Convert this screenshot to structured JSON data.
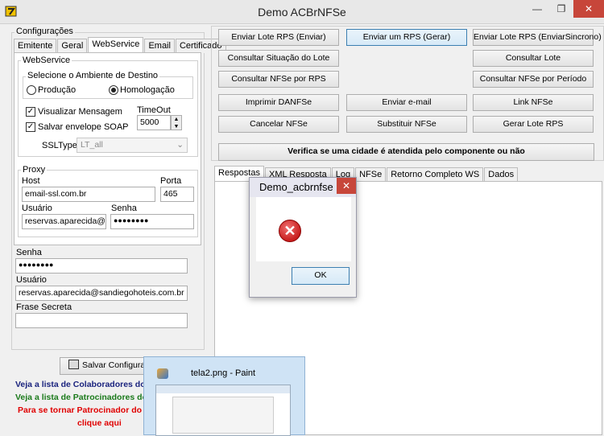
{
  "window": {
    "title": "Demo ACBrNFSe",
    "min": "—",
    "max": "❐",
    "close": "✕"
  },
  "config": {
    "group_label": "Configurações",
    "tabs": [
      "Emitente",
      "Geral",
      "WebService",
      "Email",
      "Certificado"
    ],
    "ws_group": "WebService",
    "ambiente_group": "Selecione o Ambiente de Destino",
    "producao": "Produção",
    "homologacao": "Homologação",
    "visualizar": "Visualizar Mensagem",
    "salvar_soap": "Salvar envelope SOAP",
    "timeout_label": "TimeOut",
    "timeout_value": "5000",
    "ssltype_label": "SSLType",
    "ssltype_value": "LT_all",
    "proxy_group": "Proxy",
    "host_label": "Host",
    "host_value": "email-ssl.com.br",
    "porta_label": "Porta",
    "porta_value": "465",
    "usuario_label": "Usuário",
    "usuario_value": "reservas.aparecida@sar",
    "senha_label": "Senha",
    "senha_value": "●●●●●●●●",
    "senha2_label": "Senha",
    "senha2_value": "●●●●●●●●",
    "usuario2_label": "Usuário",
    "usuario2_value": "reservas.aparecida@sandiegohoteis.com.br",
    "frase_label": "Frase Secreta",
    "frase_value": "",
    "save_button": "Salvar Configuraç"
  },
  "links": {
    "colaboradores": "Veja a lista de Colaboradores do",
    "patrocinadores": "Veja a lista de Patrocinadores do",
    "tornar": "Para se tornar Patrocinador do",
    "clique": "clique aqui"
  },
  "actions": {
    "enviar_lote": "Enviar Lote RPS (Enviar)",
    "enviar_rps": "Enviar um RPS (Gerar)",
    "enviar_lote_sinc": "Enviar Lote RPS (EnviarSincrono)",
    "consultar_situacao": "Consultar Situação do Lote",
    "consultar_lote": "Consultar Lote",
    "consultar_nfse_rps": "Consultar NFSe por RPS",
    "consultar_nfse_periodo": "Consultar NFSe por Período",
    "imprimir": "Imprimir DANFSe",
    "enviar_email": "Enviar e-mail",
    "link_nfse": "Link NFSe",
    "cancelar": "Cancelar NFSe",
    "substituir": "Substituir NFSe",
    "gerar_lote": "Gerar Lote RPS",
    "verifica": "Verifica se uma cidade é atendida pelo componente ou não"
  },
  "output_tabs": [
    "Respostas",
    "XML Resposta",
    "Log",
    "NFSe",
    "Retorno Completo WS",
    "Dados"
  ],
  "dialog": {
    "title": "Demo_acbrnfse",
    "close": "✕",
    "ok": "OK",
    "icon": "✕"
  },
  "taskbar": {
    "title": "tela2.png - Paint"
  },
  "colors": {
    "blue_link": "#1a237e",
    "green_link": "#1b7a1b",
    "red_link": "#e00000",
    "close_red": "#c7463a"
  }
}
